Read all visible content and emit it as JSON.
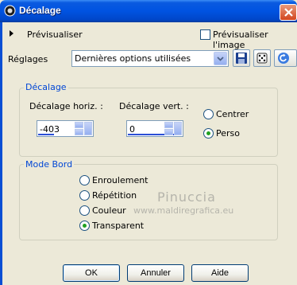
{
  "window": {
    "title": "Décalage"
  },
  "preview": {
    "label": "Prévisualiser",
    "checkbox_label": "Prévisualiser l'image",
    "checked": false
  },
  "settings": {
    "label": "Réglages",
    "selected": "Dernières options utilisées"
  },
  "offset_group": {
    "legend": "Décalage",
    "horiz_label": "Décalage horiz. :",
    "horiz_value": "-403",
    "vert_label": "Décalage vert. :",
    "vert_value": "0",
    "options": [
      {
        "label": "Centrer",
        "selected": false
      },
      {
        "label": "Perso",
        "selected": true
      }
    ]
  },
  "edge_group": {
    "legend": "Mode Bord",
    "options": [
      {
        "label": "Enroulement",
        "selected": false
      },
      {
        "label": "Répétition",
        "selected": false
      },
      {
        "label": "Couleur",
        "selected": false
      },
      {
        "label": "Transparent",
        "selected": true
      }
    ]
  },
  "watermark": {
    "line1": "Pinuccia",
    "line2": "www.maldiregrafica.eu"
  },
  "buttons": {
    "ok": "OK",
    "cancel": "Annuler",
    "help": "Aide"
  },
  "colors": {
    "title_bar": "#0053e1",
    "legend": "#0046d5",
    "radio_dot": "#21a121",
    "face": "#ece9d8"
  }
}
